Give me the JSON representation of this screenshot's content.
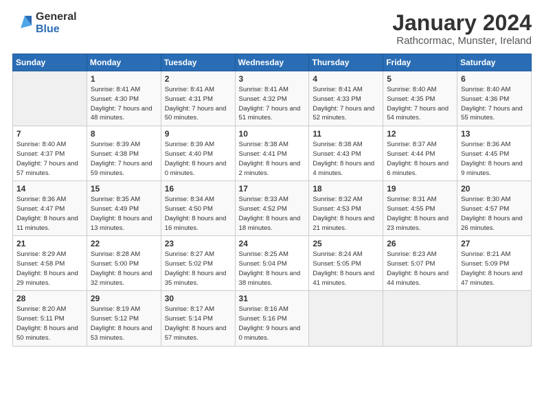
{
  "logo": {
    "line1": "General",
    "line2": "Blue"
  },
  "title": "January 2024",
  "subtitle": "Rathcormac, Munster, Ireland",
  "days_header": [
    "Sunday",
    "Monday",
    "Tuesday",
    "Wednesday",
    "Thursday",
    "Friday",
    "Saturday"
  ],
  "weeks": [
    [
      {
        "day": "",
        "sunrise": "",
        "sunset": "",
        "daylight": ""
      },
      {
        "day": "1",
        "sunrise": "Sunrise: 8:41 AM",
        "sunset": "Sunset: 4:30 PM",
        "daylight": "Daylight: 7 hours and 48 minutes."
      },
      {
        "day": "2",
        "sunrise": "Sunrise: 8:41 AM",
        "sunset": "Sunset: 4:31 PM",
        "daylight": "Daylight: 7 hours and 50 minutes."
      },
      {
        "day": "3",
        "sunrise": "Sunrise: 8:41 AM",
        "sunset": "Sunset: 4:32 PM",
        "daylight": "Daylight: 7 hours and 51 minutes."
      },
      {
        "day": "4",
        "sunrise": "Sunrise: 8:41 AM",
        "sunset": "Sunset: 4:33 PM",
        "daylight": "Daylight: 7 hours and 52 minutes."
      },
      {
        "day": "5",
        "sunrise": "Sunrise: 8:40 AM",
        "sunset": "Sunset: 4:35 PM",
        "daylight": "Daylight: 7 hours and 54 minutes."
      },
      {
        "day": "6",
        "sunrise": "Sunrise: 8:40 AM",
        "sunset": "Sunset: 4:36 PM",
        "daylight": "Daylight: 7 hours and 55 minutes."
      }
    ],
    [
      {
        "day": "7",
        "sunrise": "Sunrise: 8:40 AM",
        "sunset": "Sunset: 4:37 PM",
        "daylight": "Daylight: 7 hours and 57 minutes."
      },
      {
        "day": "8",
        "sunrise": "Sunrise: 8:39 AM",
        "sunset": "Sunset: 4:38 PM",
        "daylight": "Daylight: 7 hours and 59 minutes."
      },
      {
        "day": "9",
        "sunrise": "Sunrise: 8:39 AM",
        "sunset": "Sunset: 4:40 PM",
        "daylight": "Daylight: 8 hours and 0 minutes."
      },
      {
        "day": "10",
        "sunrise": "Sunrise: 8:38 AM",
        "sunset": "Sunset: 4:41 PM",
        "daylight": "Daylight: 8 hours and 2 minutes."
      },
      {
        "day": "11",
        "sunrise": "Sunrise: 8:38 AM",
        "sunset": "Sunset: 4:43 PM",
        "daylight": "Daylight: 8 hours and 4 minutes."
      },
      {
        "day": "12",
        "sunrise": "Sunrise: 8:37 AM",
        "sunset": "Sunset: 4:44 PM",
        "daylight": "Daylight: 8 hours and 6 minutes."
      },
      {
        "day": "13",
        "sunrise": "Sunrise: 8:36 AM",
        "sunset": "Sunset: 4:45 PM",
        "daylight": "Daylight: 8 hours and 9 minutes."
      }
    ],
    [
      {
        "day": "14",
        "sunrise": "Sunrise: 8:36 AM",
        "sunset": "Sunset: 4:47 PM",
        "daylight": "Daylight: 8 hours and 11 minutes."
      },
      {
        "day": "15",
        "sunrise": "Sunrise: 8:35 AM",
        "sunset": "Sunset: 4:49 PM",
        "daylight": "Daylight: 8 hours and 13 minutes."
      },
      {
        "day": "16",
        "sunrise": "Sunrise: 8:34 AM",
        "sunset": "Sunset: 4:50 PM",
        "daylight": "Daylight: 8 hours and 16 minutes."
      },
      {
        "day": "17",
        "sunrise": "Sunrise: 8:33 AM",
        "sunset": "Sunset: 4:52 PM",
        "daylight": "Daylight: 8 hours and 18 minutes."
      },
      {
        "day": "18",
        "sunrise": "Sunrise: 8:32 AM",
        "sunset": "Sunset: 4:53 PM",
        "daylight": "Daylight: 8 hours and 21 minutes."
      },
      {
        "day": "19",
        "sunrise": "Sunrise: 8:31 AM",
        "sunset": "Sunset: 4:55 PM",
        "daylight": "Daylight: 8 hours and 23 minutes."
      },
      {
        "day": "20",
        "sunrise": "Sunrise: 8:30 AM",
        "sunset": "Sunset: 4:57 PM",
        "daylight": "Daylight: 8 hours and 26 minutes."
      }
    ],
    [
      {
        "day": "21",
        "sunrise": "Sunrise: 8:29 AM",
        "sunset": "Sunset: 4:58 PM",
        "daylight": "Daylight: 8 hours and 29 minutes."
      },
      {
        "day": "22",
        "sunrise": "Sunrise: 8:28 AM",
        "sunset": "Sunset: 5:00 PM",
        "daylight": "Daylight: 8 hours and 32 minutes."
      },
      {
        "day": "23",
        "sunrise": "Sunrise: 8:27 AM",
        "sunset": "Sunset: 5:02 PM",
        "daylight": "Daylight: 8 hours and 35 minutes."
      },
      {
        "day": "24",
        "sunrise": "Sunrise: 8:25 AM",
        "sunset": "Sunset: 5:04 PM",
        "daylight": "Daylight: 8 hours and 38 minutes."
      },
      {
        "day": "25",
        "sunrise": "Sunrise: 8:24 AM",
        "sunset": "Sunset: 5:05 PM",
        "daylight": "Daylight: 8 hours and 41 minutes."
      },
      {
        "day": "26",
        "sunrise": "Sunrise: 8:23 AM",
        "sunset": "Sunset: 5:07 PM",
        "daylight": "Daylight: 8 hours and 44 minutes."
      },
      {
        "day": "27",
        "sunrise": "Sunrise: 8:21 AM",
        "sunset": "Sunset: 5:09 PM",
        "daylight": "Daylight: 8 hours and 47 minutes."
      }
    ],
    [
      {
        "day": "28",
        "sunrise": "Sunrise: 8:20 AM",
        "sunset": "Sunset: 5:11 PM",
        "daylight": "Daylight: 8 hours and 50 minutes."
      },
      {
        "day": "29",
        "sunrise": "Sunrise: 8:19 AM",
        "sunset": "Sunset: 5:12 PM",
        "daylight": "Daylight: 8 hours and 53 minutes."
      },
      {
        "day": "30",
        "sunrise": "Sunrise: 8:17 AM",
        "sunset": "Sunset: 5:14 PM",
        "daylight": "Daylight: 8 hours and 57 minutes."
      },
      {
        "day": "31",
        "sunrise": "Sunrise: 8:16 AM",
        "sunset": "Sunset: 5:16 PM",
        "daylight": "Daylight: 9 hours and 0 minutes."
      },
      {
        "day": "",
        "sunrise": "",
        "sunset": "",
        "daylight": ""
      },
      {
        "day": "",
        "sunrise": "",
        "sunset": "",
        "daylight": ""
      },
      {
        "day": "",
        "sunrise": "",
        "sunset": "",
        "daylight": ""
      }
    ]
  ]
}
